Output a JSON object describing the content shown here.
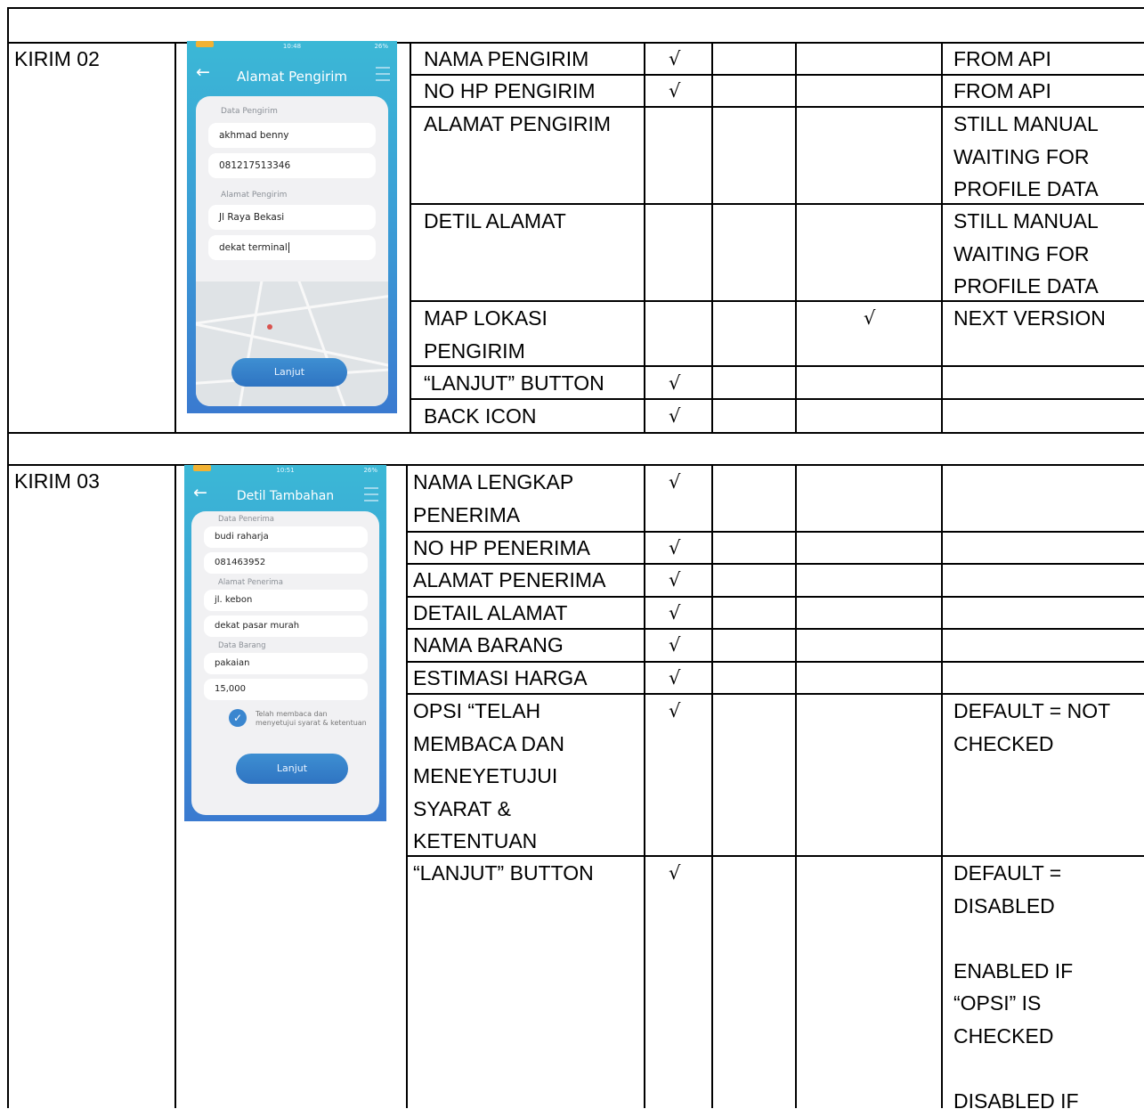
{
  "rows": [
    {
      "id": "KIRIM 02",
      "screen": {
        "title": "Alamat Pengirim",
        "time": "10:48",
        "battery": "26%",
        "sender_label": "Data Pengirim",
        "name_value": "akhmad benny",
        "phone_value": "081217513346",
        "address_label": "Alamat Pengirim",
        "address_value": "Jl Raya Bekasi",
        "detail_value": "dekat terminal",
        "button_label": "Lanjut"
      },
      "items": [
        {
          "feature": "NAMA PENGIRIM",
          "c1": "√",
          "c2": "",
          "c3": "",
          "note": "FROM API"
        },
        {
          "feature": "NO HP PENGIRIM",
          "c1": "√",
          "c2": "",
          "c3": "",
          "note": "FROM API"
        },
        {
          "feature": "ALAMAT PENGIRIM",
          "c1": "",
          "c2": "",
          "c3": "",
          "note": "STILL MANUAL\nWAITING FOR\nPROFILE DATA"
        },
        {
          "feature": "DETIL ALAMAT",
          "c1": "",
          "c2": "",
          "c3": "",
          "note": "STILL MANUAL\nWAITING FOR\nPROFILE DATA"
        },
        {
          "feature": "MAP LOKASI\nPENGIRIM",
          "c1": "",
          "c2": "",
          "c3": "√",
          "note": "NEXT VERSION"
        },
        {
          "feature": "“LANJUT” BUTTON",
          "c1": "√",
          "c2": "",
          "c3": "",
          "note": ""
        },
        {
          "feature": "BACK ICON",
          "c1": "√",
          "c2": "",
          "c3": "",
          "note": ""
        }
      ]
    },
    {
      "id": "KIRIM 03",
      "screen": {
        "title": "Detil Tambahan",
        "time": "10:51",
        "battery": "26%",
        "receiver_label": "Data Penerima",
        "name_value": "budi raharja",
        "phone_value": "081463952",
        "address_label": "Alamat Penerima",
        "address_value": "jl. kebon",
        "detail_value": "dekat pasar murah",
        "goods_label": "Data Barang",
        "goods_value": "pakaian",
        "price_value": "15,000",
        "terms_text": "Telah membaca dan\nmenyetujui syarat & ketentuan",
        "button_label": "Lanjut"
      },
      "items": [
        {
          "feature": "NAMA LENGKAP\nPENERIMA",
          "c1": "√",
          "c2": "",
          "c3": "",
          "note": ""
        },
        {
          "feature": "NO HP PENERIMA",
          "c1": "√",
          "c2": "",
          "c3": "",
          "note": ""
        },
        {
          "feature": "ALAMAT PENERIMA",
          "c1": "√",
          "c2": "",
          "c3": "",
          "note": ""
        },
        {
          "feature": "DETAIL ALAMAT",
          "c1": "√",
          "c2": "",
          "c3": "",
          "note": ""
        },
        {
          "feature": "NAMA BARANG",
          "c1": "√",
          "c2": "",
          "c3": "",
          "note": ""
        },
        {
          "feature": "ESTIMASI HARGA",
          "c1": "√",
          "c2": "",
          "c3": "",
          "note": ""
        },
        {
          "feature": "OPSI “TELAH\nMEMBACA DAN\nMENEYETUJUI\nSYARAT &\nKETENTUAN",
          "c1": "√",
          "c2": "",
          "c3": "",
          "note": "DEFAULT = NOT\nCHECKED"
        },
        {
          "feature": "“LANJUT” BUTTON",
          "c1": "√",
          "c2": "",
          "c3": "",
          "note": "DEFAULT =\nDISABLED\n\nENABLED IF\n“OPSI” IS\nCHECKED\n\nDISABLED IF"
        }
      ]
    }
  ]
}
